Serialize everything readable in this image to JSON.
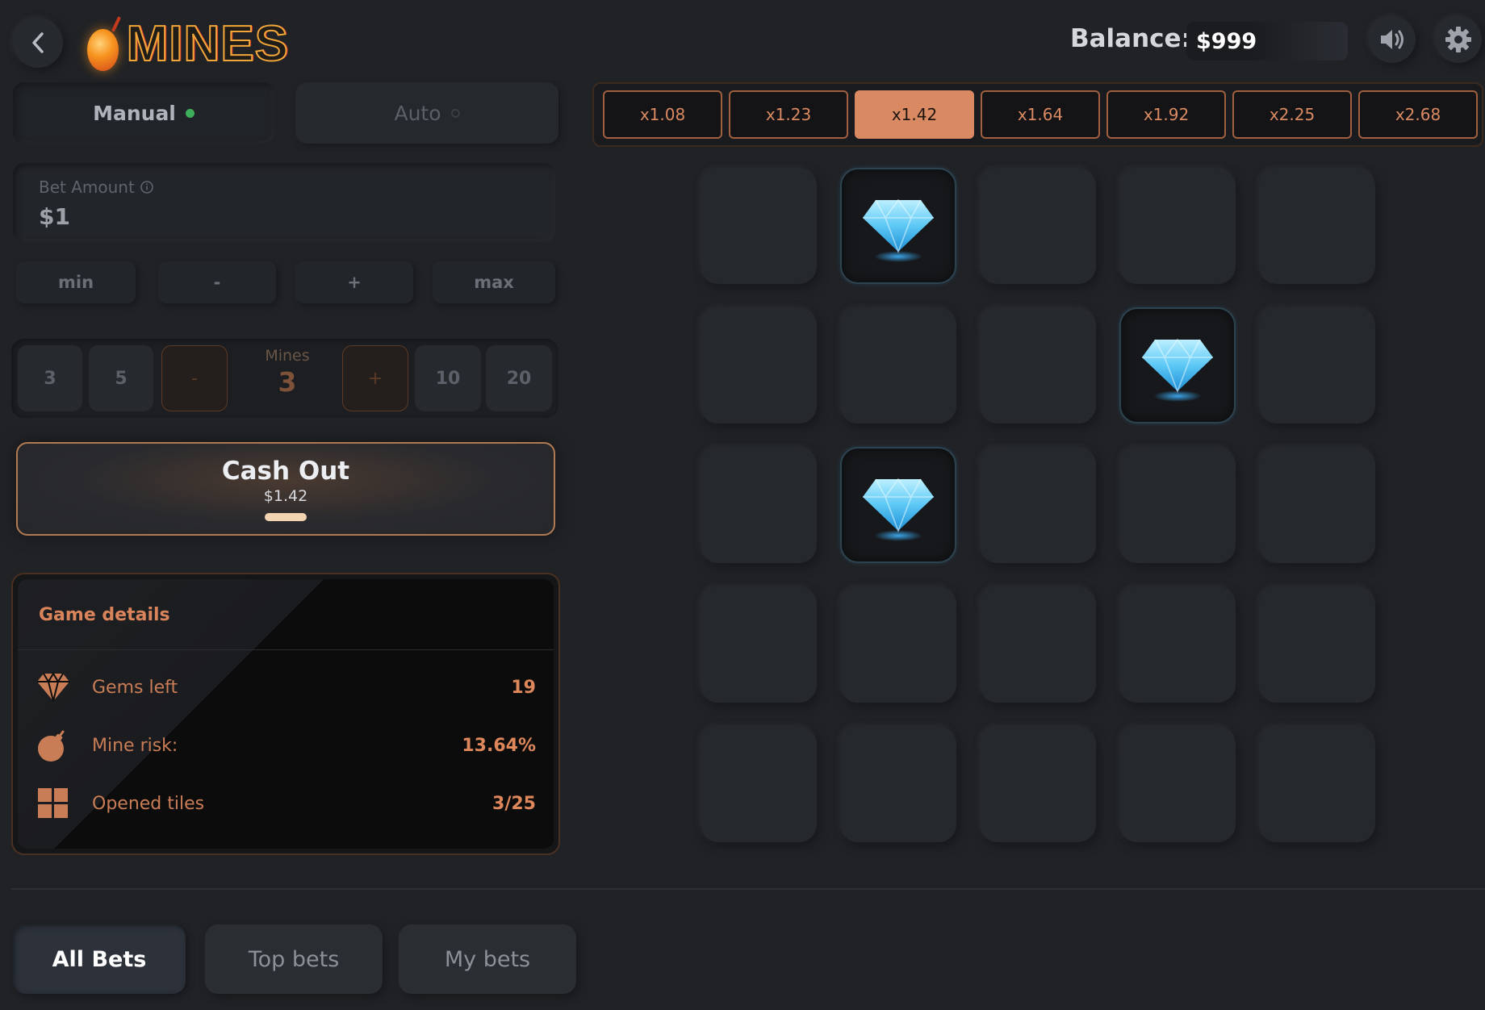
{
  "header": {
    "logo_text": "MINES",
    "balance_label": "Balance:",
    "balance_value": "$999"
  },
  "mode_tabs": [
    {
      "label": "Manual",
      "active": true,
      "status_color": "#3fae5a"
    },
    {
      "label": "Auto",
      "active": false,
      "status_color": "#3a3d42"
    }
  ],
  "bet": {
    "label": "Bet Amount",
    "value": "$1",
    "quick_buttons": [
      "min",
      "-",
      "+",
      "max"
    ]
  },
  "mines_selector": {
    "label": "Mines",
    "value": "3",
    "presets_left": [
      "3",
      "5"
    ],
    "presets_right": [
      "10",
      "20"
    ],
    "decrement": "-",
    "increment": "+"
  },
  "cashout": {
    "title": "Cash Out",
    "amount": "$1.42"
  },
  "game_details": {
    "title": "Game details",
    "rows": [
      {
        "icon": "diamond-icon",
        "label": "Gems left",
        "value": "19"
      },
      {
        "icon": "bomb-icon",
        "label": "Mine risk:",
        "value": "13.64%"
      },
      {
        "icon": "tiles-icon",
        "label": "Opened tiles",
        "value": "3/25"
      }
    ]
  },
  "multipliers": {
    "values": [
      "x1.08",
      "x1.23",
      "x1.42",
      "x1.64",
      "x1.92",
      "x2.25",
      "x2.68"
    ],
    "active_index": 2
  },
  "grid": {
    "rows": 5,
    "cols": 5,
    "revealed_gems": [
      [
        0,
        1
      ],
      [
        1,
        3
      ],
      [
        2,
        1
      ]
    ]
  },
  "bottom_tabs": [
    {
      "label": "All Bets",
      "active": true
    },
    {
      "label": "Top bets",
      "active": false
    },
    {
      "label": "My bets",
      "active": false
    }
  ],
  "colors": {
    "accent": "#d98a62",
    "background": "#202226",
    "gem": "#5cc8f5"
  }
}
